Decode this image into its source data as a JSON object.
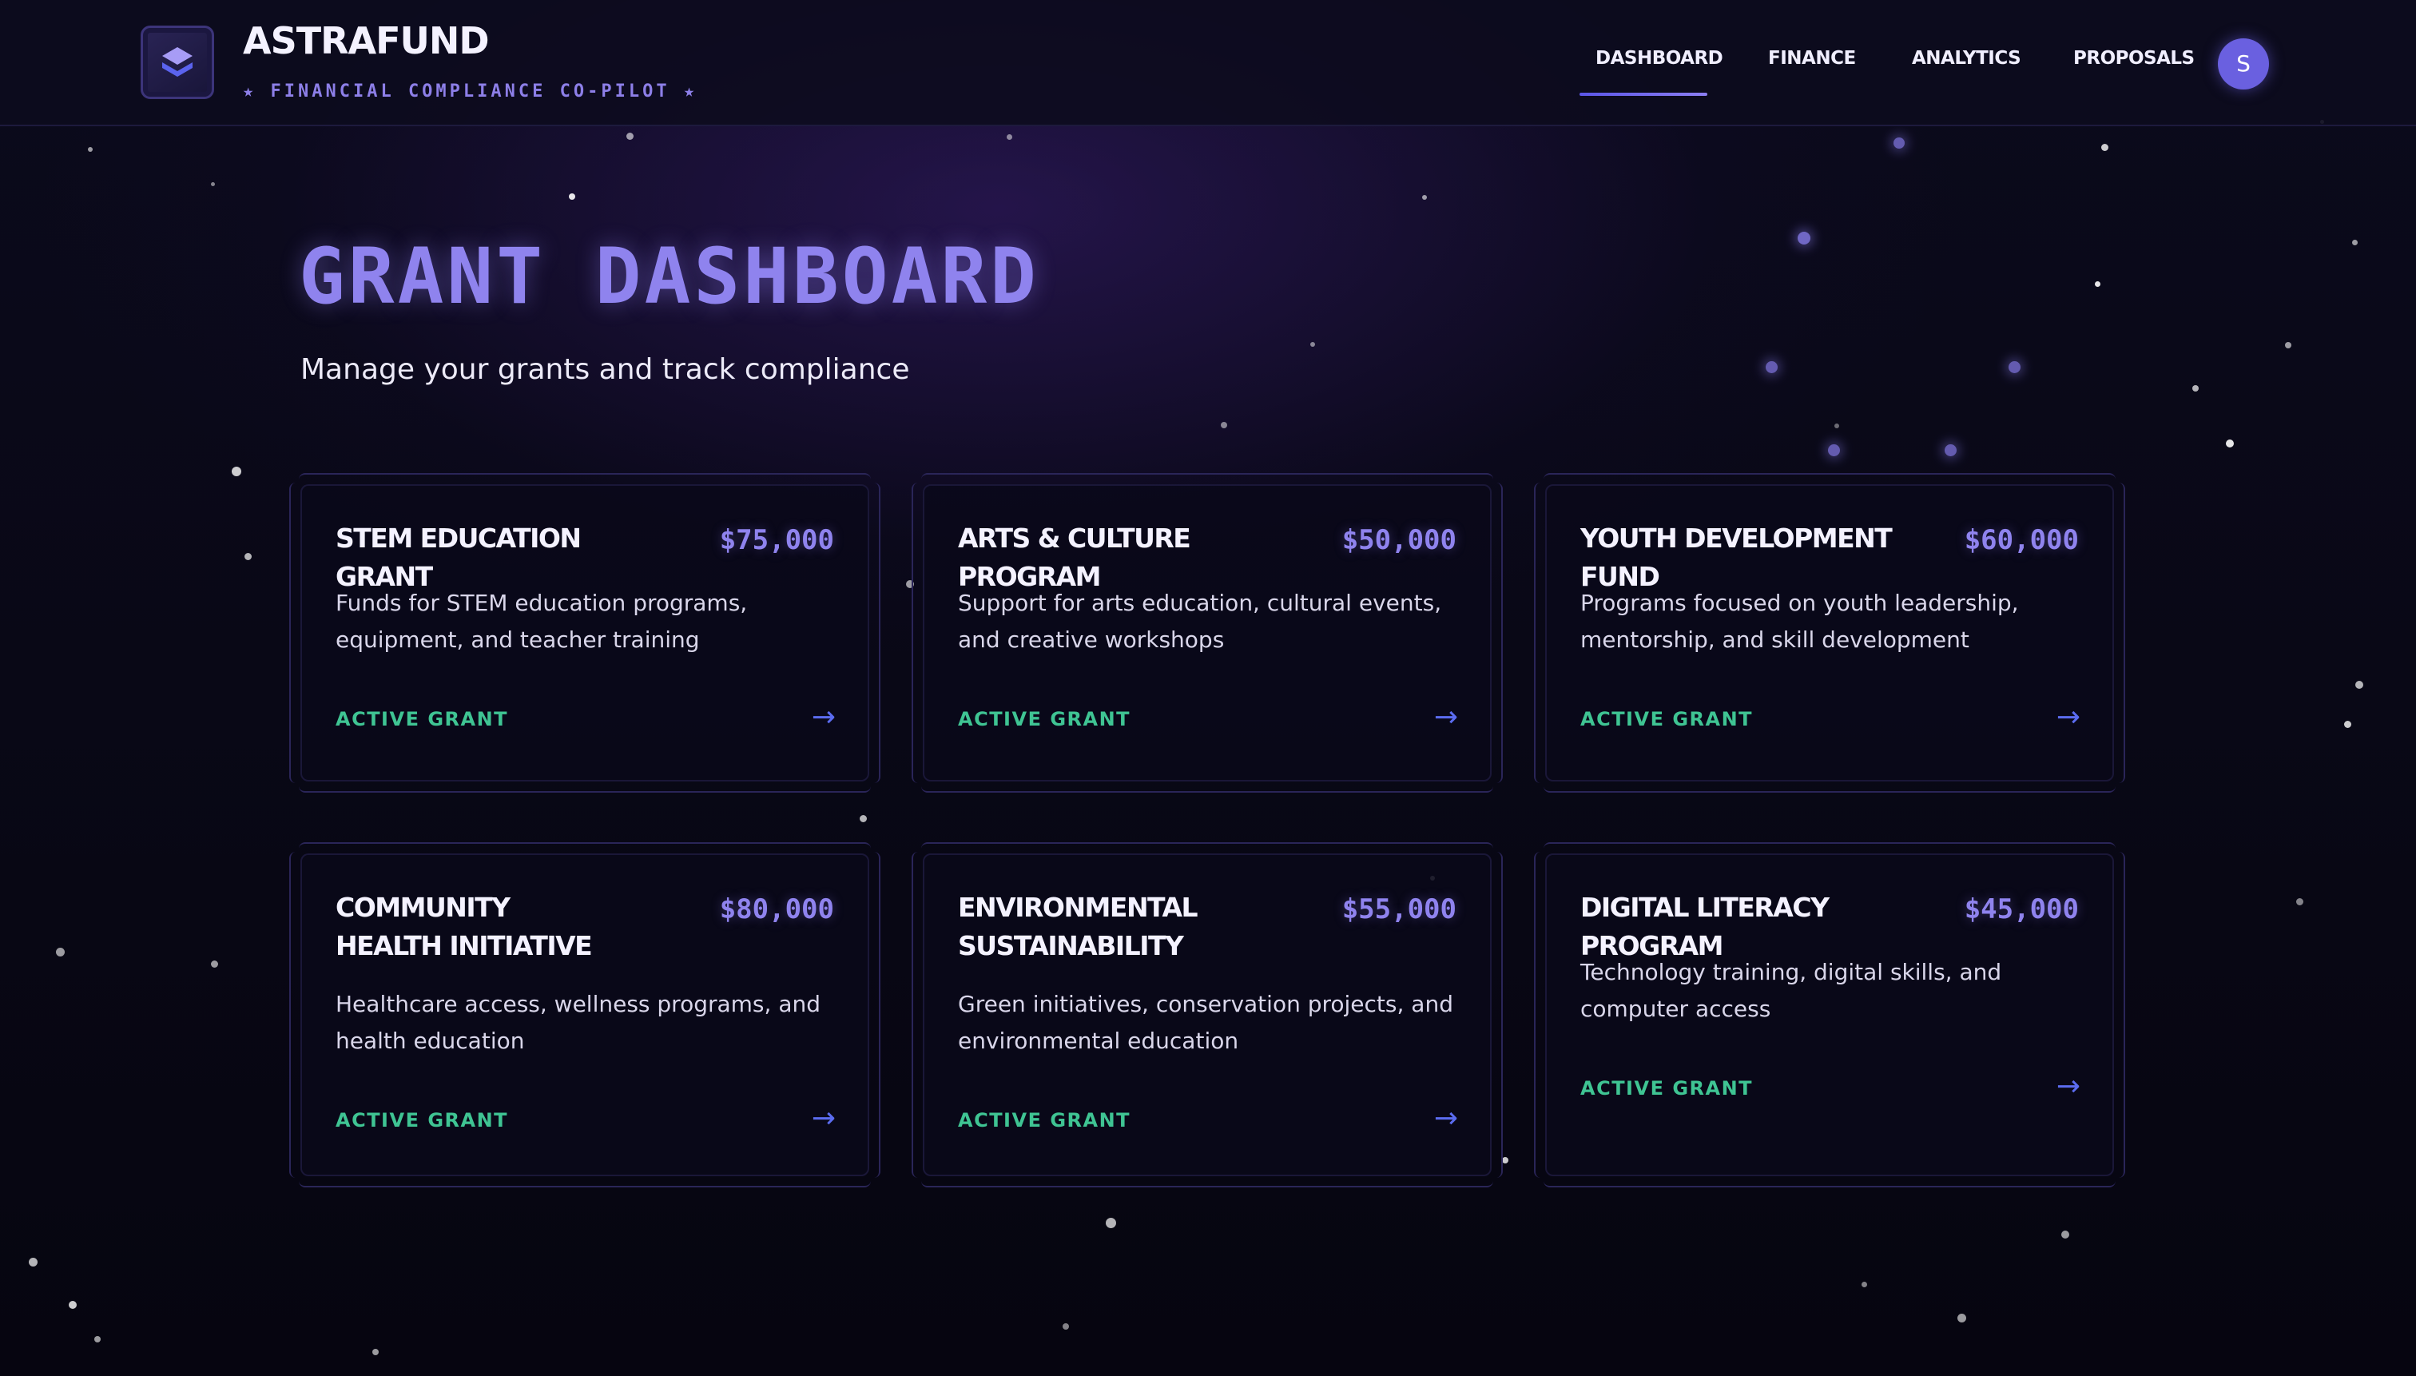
{
  "app": {
    "name": "ASTRAFUND",
    "tagline": "★ FINANCIAL COMPLIANCE CO-PILOT ★",
    "logo_icon": "layers-icon"
  },
  "nav": {
    "items": [
      {
        "label": "DASHBOARD",
        "active": true
      },
      {
        "label": "FINANCE",
        "active": false
      },
      {
        "label": "ANALYTICS",
        "active": false
      },
      {
        "label": "PROPOSALS",
        "active": false
      }
    ],
    "avatar_initial": "S"
  },
  "page": {
    "title": "GRANT DASHBOARD",
    "subtitle": "Manage your grants and track compliance"
  },
  "grants": [
    {
      "title": "STEM EDUCATION GRANT",
      "amount": "$75,000",
      "description": "Funds for STEM education programs, equipment, and teacher training",
      "status": "ACTIVE GRANT",
      "arrow": "→"
    },
    {
      "title": "ARTS & CULTURE PROGRAM",
      "amount": "$50,000",
      "description": "Support for arts education, cultural events, and creative workshops",
      "status": "ACTIVE GRANT",
      "arrow": "→"
    },
    {
      "title": "YOUTH DEVELOPMENT FUND",
      "amount": "$60,000",
      "description": "Programs focused on youth leadership, mentorship, and skill development",
      "status": "ACTIVE GRANT",
      "arrow": "→"
    },
    {
      "title": "COMMUNITY HEALTH INITIATIVE",
      "amount": "$80,000",
      "description": "Healthcare access, wellness programs, and health education",
      "status": "ACTIVE GRANT",
      "arrow": "→"
    },
    {
      "title": "ENVIRONMENTAL SUSTAINABILITY",
      "amount": "$55,000",
      "description": "Green initiatives, conservation projects, and environmental education",
      "status": "ACTIVE GRANT",
      "arrow": "→"
    },
    {
      "title": "DIGITAL LITERACY PROGRAM",
      "amount": "$45,000",
      "description": "Technology training, digital skills, and computer access",
      "status": "ACTIVE GRANT",
      "arrow": "→"
    }
  ],
  "colors": {
    "accent": "#8f83ee",
    "status_active": "#3fc493",
    "arrow": "#5b6cf0",
    "background": "#07060f"
  }
}
